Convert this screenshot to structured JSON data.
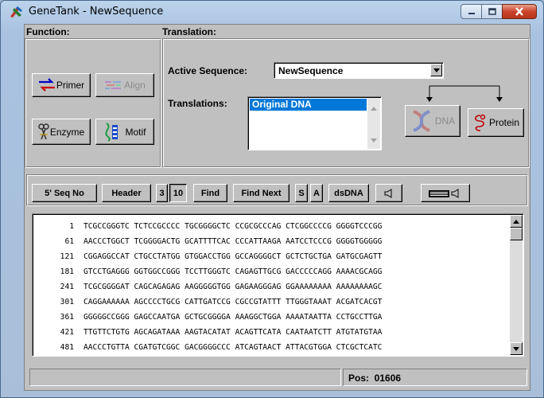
{
  "window": {
    "title": "GeneTank - NewSequence",
    "icons": {
      "app": "genetank-logo-icon",
      "minimize": "minimize-icon",
      "maximize": "maximize-icon",
      "close": "close-icon"
    }
  },
  "function_panel": {
    "label": "Function:",
    "buttons": [
      {
        "label": "Primer",
        "icon": "primer-arrows-icon",
        "enabled": true
      },
      {
        "label": "Align",
        "icon": "align-icon",
        "enabled": false
      },
      {
        "label": "Enzyme",
        "icon": "enzyme-scissors-icon",
        "enabled": true
      },
      {
        "label": "Motif",
        "icon": "motif-icon",
        "enabled": true
      }
    ]
  },
  "translation_panel": {
    "label": "Translation:",
    "active_sequence_label": "Active Sequence:",
    "active_sequence_value": "NewSequence",
    "translations_label": "Translations:",
    "translations": [
      "Original DNA"
    ],
    "dna_button": "DNA",
    "protein_button": "Protein"
  },
  "toolbar": {
    "seq_no": "5' Seq No",
    "header": "Header",
    "frame_3": "3",
    "frame_10": "10",
    "find": "Find",
    "find_next": "Find Next",
    "s": "S",
    "a": "A",
    "dsdna": "dsDNA",
    "speaker_icon": "speaker-icon",
    "keyboard_icon": "keyboard-speaker-icon"
  },
  "sequence": {
    "rows": [
      {
        "num": "1",
        "seq": "TCGCCGGGTC TCTCCGCCCC TGCGGGGCTC CCGCGCCCAG CTCGGCCCCG GGGGTCCCGG"
      },
      {
        "num": "61",
        "seq": "AACCCTGGCT TCGGGGACTG GCATTTTCAC CCCATTAAGA AATCCTCCCG GGGGTGGGGG"
      },
      {
        "num": "121",
        "seq": "CGGAGGCCAT CTGCCTATGG GTGGACCTGG GCCAGGGGCT GCTCTGCTGA GATGCGAGTT"
      },
      {
        "num": "181",
        "seq": "GTCCTGAGGG GGTGGCCGGG TCCTTGGGTC CAGAGTTGCG GACCCCCAGG AAAACGCAGG"
      },
      {
        "num": "241",
        "seq": "TCGCGGGGAT CAGCAGAGAG AAGGGGGTGG GAGAAGGGAG GGAAAAAAAA AAAAAAAAGC"
      },
      {
        "num": "301",
        "seq": "CAGGAAAAAA AGCCCCTGCG CATTGATCCG CGCCGTATTT TTGGGTAAAT ACGATCACGT"
      },
      {
        "num": "361",
        "seq": "GGGGGCCGGG GAGCCAATGA GCTGCGGGGA AAAGGCTGGA AAAATAATTA CCTGCCTTGA"
      },
      {
        "num": "421",
        "seq": "TTGTTCTGTG AGCAGATAAA AAGTACATAT ACAGTTCATA CAATAATCTT ATGTATGTAA"
      },
      {
        "num": "481",
        "seq": "AACCCTGTTA CGATGTCGGC GACGGGGCCC ATCAGTAACT ATTACGTGGA CTCGCTCATC"
      }
    ]
  },
  "status": {
    "left": "",
    "position": "Pos:  01606"
  }
}
